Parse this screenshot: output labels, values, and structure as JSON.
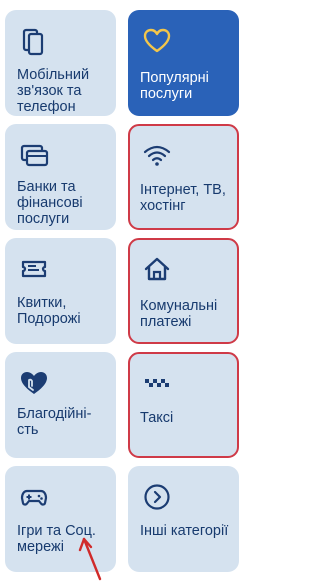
{
  "tiles": [
    {
      "label": "Мобільний зв'язок та телефон",
      "icon": "phone-icon",
      "selected": false,
      "highlighted": false
    },
    {
      "label": "Популярні послуги",
      "icon": "heart-icon",
      "selected": true,
      "highlighted": false
    },
    {
      "label": "Банки та фінансові послуги",
      "icon": "cards-icon",
      "selected": false,
      "highlighted": false
    },
    {
      "label": "Інтернет, ТВ, хостінг",
      "icon": "wifi-icon",
      "selected": false,
      "highlighted": true
    },
    {
      "label": "Квитки, Подорожі",
      "icon": "ticket-icon",
      "selected": false,
      "highlighted": false
    },
    {
      "label": "Комунальні платежі",
      "icon": "house-icon",
      "selected": false,
      "highlighted": true
    },
    {
      "label": "Благодійні-сть",
      "icon": "charity-heart-icon",
      "selected": false,
      "highlighted": false
    },
    {
      "label": "Таксі",
      "icon": "taxi-checker-icon",
      "selected": false,
      "highlighted": true
    },
    {
      "label": "Ігри та Соц. мережі",
      "icon": "gamepad-icon",
      "selected": false,
      "highlighted": false
    },
    {
      "label": "Інші категорії",
      "icon": "chevron-right-circle-icon",
      "selected": false,
      "highlighted": false
    }
  ],
  "colors": {
    "tile_bg": "#d5e2ef",
    "tile_selected_bg": "#2a62b8",
    "label_text": "#173a6e",
    "icon_stroke": "#1c3d73",
    "selected_icon_stroke": "#f3c64a",
    "highlight_border": "#cf3a47",
    "arrow": "#d02a2a"
  }
}
